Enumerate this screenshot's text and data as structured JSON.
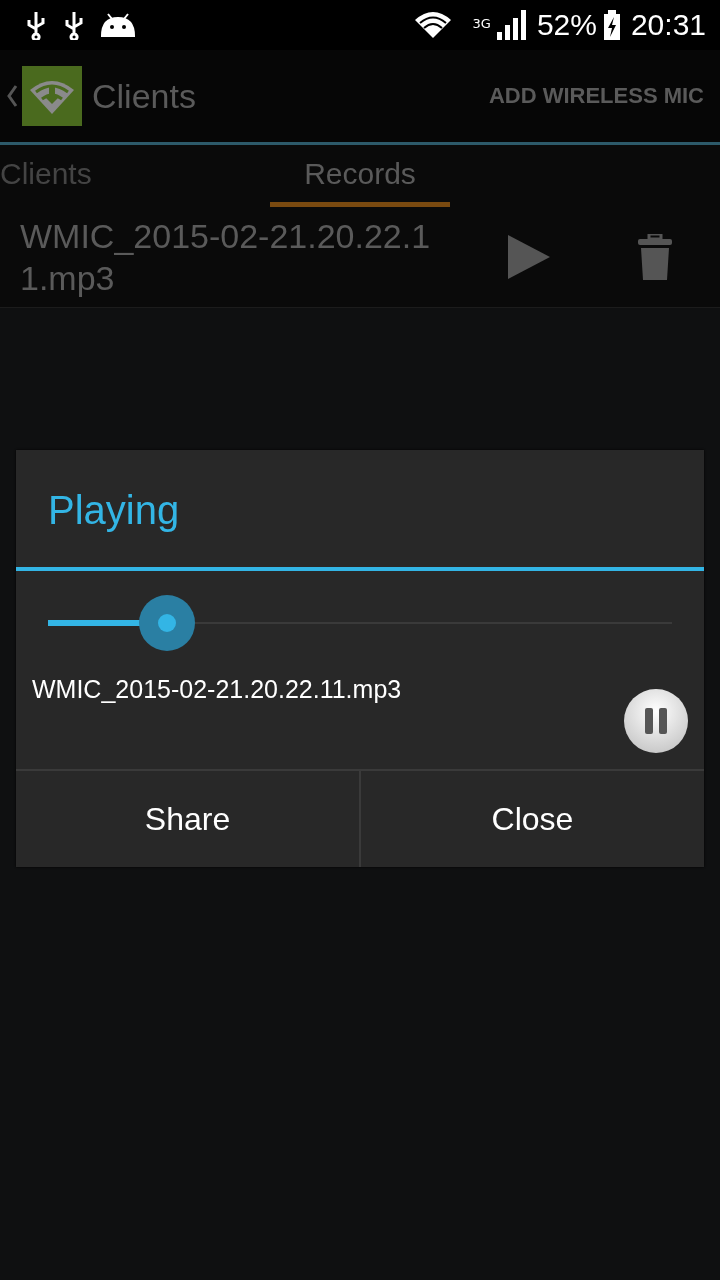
{
  "status_bar": {
    "clock": "20:31",
    "battery_text": "52%",
    "network": "3G"
  },
  "action_bar": {
    "title": "Clients",
    "action": "ADD WIRELESS MIC"
  },
  "tabs": [
    {
      "label": "Clients",
      "selected": false
    },
    {
      "label": "Records",
      "selected": true
    }
  ],
  "records": [
    {
      "name": "WMIC_2015-02-21.20.22.11.mp3"
    }
  ],
  "dialog": {
    "title": "Playing",
    "level": 0.19,
    "file": "WMIC_2015-02-21.20.22.11.mp3",
    "playing": true,
    "buttons": [
      "Share",
      "Close"
    ]
  }
}
